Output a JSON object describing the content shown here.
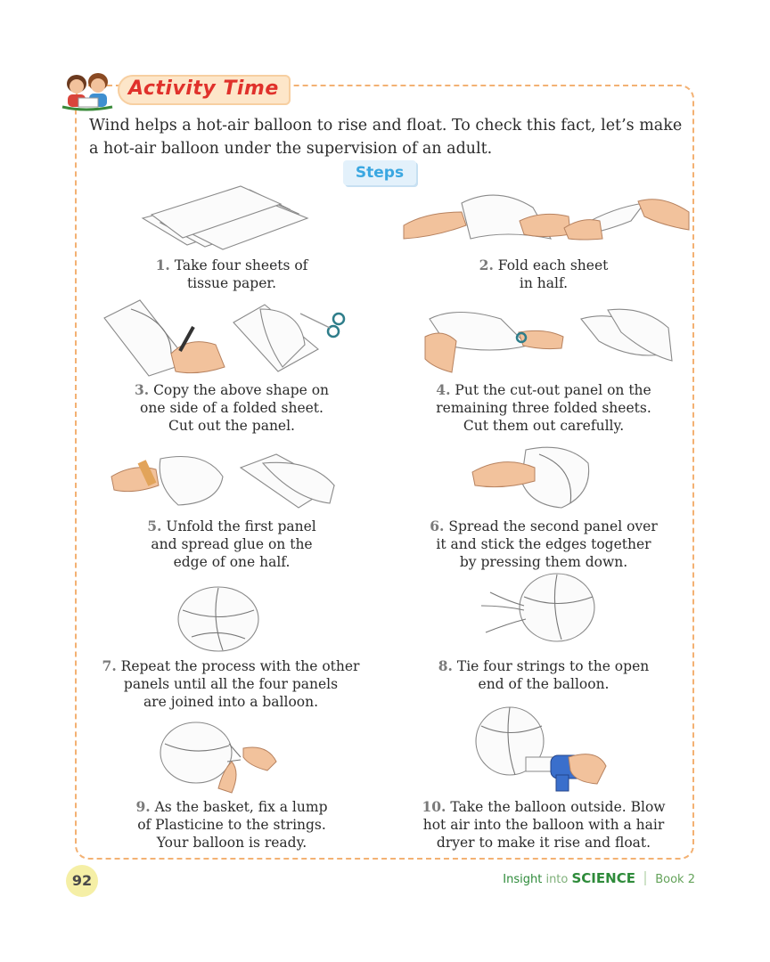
{
  "header": {
    "title": "Activity Time"
  },
  "intro": "Wind helps a hot-air balloon to rise and float. To check this fact, let’s make a hot-air balloon under the supervision of an adult.",
  "steps_label": "Steps",
  "steps": [
    {
      "num": "1.",
      "text": "Take four sheets of\ntissue paper."
    },
    {
      "num": "2.",
      "text": "Fold each sheet\nin half."
    },
    {
      "num": "3.",
      "text": "Copy the above shape on\none side of a folded sheet.\nCut out the panel."
    },
    {
      "num": "4.",
      "text": "Put the cut-out panel on the\nremaining three folded sheets.\nCut them out carefully."
    },
    {
      "num": "5.",
      "text": "Unfold the first panel\nand spread glue on the\nedge of one half."
    },
    {
      "num": "6.",
      "text": "Spread the second panel over\nit and stick the edges together\nby pressing them down."
    },
    {
      "num": "7.",
      "text": "Repeat the process with the other\npanels until all the four panels\nare joined into a balloon."
    },
    {
      "num": "8.",
      "text": "Tie four strings to the open\nend of the balloon."
    },
    {
      "num": "9.",
      "text": "As the basket, fix a lump\nof Plasticine to the strings.\nYour balloon is ready."
    },
    {
      "num": "10.",
      "text": "Take the balloon outside. Blow\nhot air into the balloon with a hair\ndryer to make it rise and float."
    }
  ],
  "footer": {
    "page_number": "92",
    "series_a": "Insight",
    "series_b": "into",
    "series_c": "SCIENCE",
    "book": "Book 2"
  },
  "colors": {
    "title_red": "#e0312b",
    "border_orange": "#f3b173",
    "steps_blue": "#3aa7e1",
    "footer_green": "#2e8b3a"
  }
}
